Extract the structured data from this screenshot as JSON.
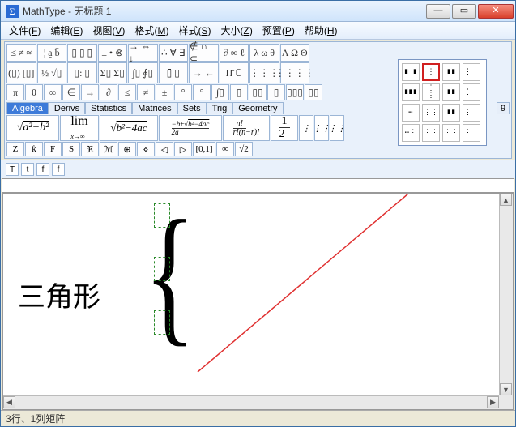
{
  "window": {
    "title": "MathType - 无标题 1"
  },
  "win_buttons": {
    "min": "—",
    "max": "▭",
    "close": "✕"
  },
  "menus": [
    {
      "label": "文件",
      "acc": "F"
    },
    {
      "label": "编辑",
      "acc": "E"
    },
    {
      "label": "视图",
      "acc": "V"
    },
    {
      "label": "格式",
      "acc": "M"
    },
    {
      "label": "样式",
      "acc": "S"
    },
    {
      "label": "大小",
      "acc": "Z"
    },
    {
      "label": "预置",
      "acc": "P"
    },
    {
      "label": "帮助",
      "acc": "H"
    }
  ],
  "tool_rows": {
    "r1": [
      "≤ ≠ ≈",
      "¦ a̱ b̄",
      "▯ ▯ ▯",
      "± • ⊗",
      "→ ⇔ ↓",
      "∴ ∀ ∃",
      "∉ ∩ ⊂",
      "∂ ∞ ℓ",
      "λ ω θ",
      "Λ Ω Θ"
    ],
    "r2": [
      "(▯) [▯]",
      "½ √▯",
      "▯: ▯",
      "Σ▯ Σ▯",
      "∫▯ ∮▯",
      "▯̄ ▯",
      "→ ←",
      "Π̄ Ū",
      "⋮⋮⋮",
      "⋮⋮⋮⋮"
    ],
    "r3": [
      "π",
      "θ",
      "∞",
      "∈",
      "→",
      "∂",
      "≤",
      "≠",
      "±",
      "°",
      "°",
      "",
      "∫▯",
      "▯",
      "▯▯",
      "▯",
      "▯▯▯",
      "▯▯"
    ],
    "r6": [
      "Z",
      "ƙ",
      "F",
      "S",
      "ℜ",
      "ℳ",
      "⊕",
      "⋄",
      "◁",
      "▷",
      "[0,1]",
      "∞",
      "√2"
    ]
  },
  "tabs": {
    "items": [
      "Algebra",
      "Derivs",
      "Statistics",
      "Matrices",
      "Sets",
      "Trig",
      "Geometry"
    ],
    "active": 0,
    "nums": [
      "9"
    ]
  },
  "formulas": [
    "√(a²+b²)",
    "lim x→∞",
    "√(b²−4ac)",
    "(−b±√(b²−4ac))/2a",
    "n! / r!(n−r)!",
    "1/2",
    "⋮",
    "⋮⋮",
    "⋮⋮"
  ],
  "stylebar": [
    "T",
    "t",
    "f",
    "f"
  ],
  "canvas": {
    "text": "三角形"
  },
  "status": "3行、1列矩阵",
  "matrix_pop": [
    "∎ ∎",
    "⋮",
    "∎∎",
    "⋮⋮",
    "∎∎∎",
    "⋮ ⋮",
    "∎∎",
    "⋮⋮",
    "⋯",
    "⋮⋮",
    "∎∎",
    "⋮⋮",
    "⋯⋮",
    "⋮⋮",
    "⋮⋮",
    "⋮⋮"
  ]
}
